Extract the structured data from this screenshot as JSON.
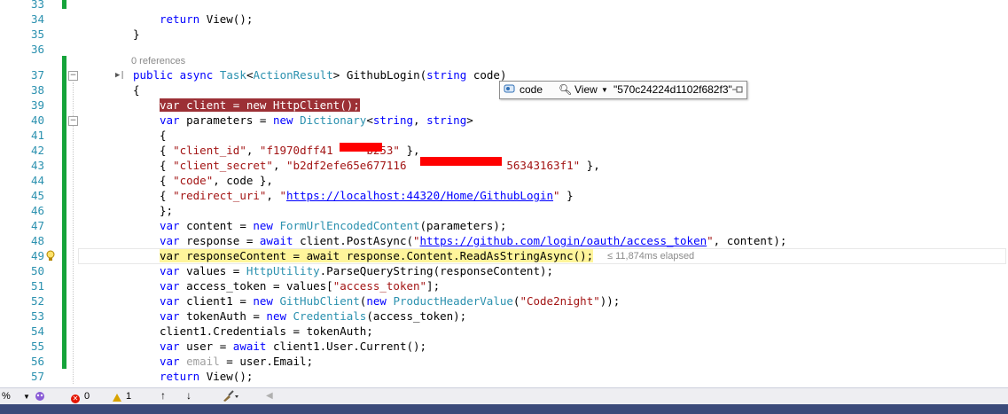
{
  "editor": {
    "codelens": "0 references",
    "elapsed": "≤ 11,874ms elapsed",
    "lines": [
      {
        "num": "33",
        "tokens": []
      },
      {
        "num": "34",
        "tokens": [
          {
            "t": "return ",
            "c": "kw"
          },
          {
            "t": "View();",
            "c": ""
          }
        ]
      },
      {
        "num": "35",
        "tokens": [
          {
            "t": "}",
            "c": ""
          }
        ]
      },
      {
        "num": "36",
        "tokens": []
      },
      {
        "num": "37",
        "tokens": [
          {
            "t": "public async ",
            "c": "kw"
          },
          {
            "t": "Task",
            "c": "ty"
          },
          {
            "t": "<",
            "c": ""
          },
          {
            "t": "ActionResult",
            "c": "ty"
          },
          {
            "t": "> GithubLogin(",
            "c": ""
          },
          {
            "t": "string",
            "c": "kw"
          },
          {
            "t": " code)",
            "c": ""
          }
        ]
      },
      {
        "num": "38",
        "tokens": [
          {
            "t": "{",
            "c": ""
          }
        ]
      },
      {
        "num": "39",
        "tokens": [
          {
            "t": "var client = new HttpClient();",
            "c": "bp"
          }
        ]
      },
      {
        "num": "40",
        "tokens": [
          {
            "t": "var ",
            "c": "kw"
          },
          {
            "t": "parameters = ",
            "c": ""
          },
          {
            "t": "new ",
            "c": "kw"
          },
          {
            "t": "Dictionary",
            "c": "ty"
          },
          {
            "t": "<",
            "c": ""
          },
          {
            "t": "string",
            "c": "kw"
          },
          {
            "t": ", ",
            "c": ""
          },
          {
            "t": "string",
            "c": "kw"
          },
          {
            "t": ">",
            "c": ""
          }
        ]
      },
      {
        "num": "41",
        "tokens": [
          {
            "t": "{",
            "c": ""
          }
        ]
      },
      {
        "num": "42",
        "tokens": [
          {
            "t": "{ ",
            "c": ""
          },
          {
            "t": "\"client_id\"",
            "c": "st"
          },
          {
            "t": ", ",
            "c": ""
          },
          {
            "t": "\"f1970dff41     b253\"",
            "c": "st"
          },
          {
            "t": " },",
            "c": ""
          }
        ]
      },
      {
        "num": "43",
        "tokens": [
          {
            "t": "{ ",
            "c": ""
          },
          {
            "t": "\"client_secret\"",
            "c": "st"
          },
          {
            "t": ", ",
            "c": ""
          },
          {
            "t": "\"b2df2efe65e677116               56343163f1\"",
            "c": "st"
          },
          {
            "t": " },",
            "c": ""
          }
        ]
      },
      {
        "num": "44",
        "tokens": [
          {
            "t": "{ ",
            "c": ""
          },
          {
            "t": "\"code\"",
            "c": "st"
          },
          {
            "t": ", code },",
            "c": ""
          }
        ]
      },
      {
        "num": "45",
        "tokens": [
          {
            "t": "{ ",
            "c": ""
          },
          {
            "t": "\"redirect_uri\"",
            "c": "st"
          },
          {
            "t": ", ",
            "c": ""
          },
          {
            "t": "\"",
            "c": "st"
          },
          {
            "t": "https://localhost:44320/Home/GithubLogin",
            "c": "url"
          },
          {
            "t": "\"",
            "c": "st"
          },
          {
            "t": " }",
            "c": ""
          }
        ]
      },
      {
        "num": "46",
        "tokens": [
          {
            "t": "};",
            "c": ""
          }
        ]
      },
      {
        "num": "47",
        "tokens": [
          {
            "t": "var ",
            "c": "kw"
          },
          {
            "t": "content = ",
            "c": ""
          },
          {
            "t": "new ",
            "c": "kw"
          },
          {
            "t": "FormUrlEncodedContent",
            "c": "ty"
          },
          {
            "t": "(parameters);",
            "c": ""
          }
        ]
      },
      {
        "num": "48",
        "tokens": [
          {
            "t": "var ",
            "c": "kw"
          },
          {
            "t": "response = ",
            "c": ""
          },
          {
            "t": "await ",
            "c": "kw"
          },
          {
            "t": "client.PostAsync(",
            "c": ""
          },
          {
            "t": "\"",
            "c": "st"
          },
          {
            "t": "https://github.com/login/oauth/access_token",
            "c": "url"
          },
          {
            "t": "\"",
            "c": "st"
          },
          {
            "t": ", content);",
            "c": ""
          }
        ]
      },
      {
        "num": "49",
        "tokens": [
          {
            "t": "var responseContent = await response.Content.ReadAsStringAsync();",
            "c": "cur"
          }
        ]
      },
      {
        "num": "50",
        "tokens": [
          {
            "t": "var ",
            "c": "kw"
          },
          {
            "t": "values = ",
            "c": ""
          },
          {
            "t": "HttpUtility",
            "c": "ty"
          },
          {
            "t": ".ParseQueryString(responseContent);",
            "c": ""
          }
        ]
      },
      {
        "num": "51",
        "tokens": [
          {
            "t": "var ",
            "c": "kw"
          },
          {
            "t": "access_token = values[",
            "c": ""
          },
          {
            "t": "\"access_token\"",
            "c": "st"
          },
          {
            "t": "];",
            "c": ""
          }
        ]
      },
      {
        "num": "52",
        "tokens": [
          {
            "t": "var ",
            "c": "kw"
          },
          {
            "t": "client1 = ",
            "c": ""
          },
          {
            "t": "new ",
            "c": "kw"
          },
          {
            "t": "GitHubClient",
            "c": "ty"
          },
          {
            "t": "(",
            "c": ""
          },
          {
            "t": "new ",
            "c": "kw"
          },
          {
            "t": "ProductHeaderValue",
            "c": "ty"
          },
          {
            "t": "(",
            "c": ""
          },
          {
            "t": "\"Code2night\"",
            "c": "st"
          },
          {
            "t": "));",
            "c": ""
          }
        ]
      },
      {
        "num": "53",
        "tokens": [
          {
            "t": "var ",
            "c": "kw"
          },
          {
            "t": "tokenAuth = ",
            "c": ""
          },
          {
            "t": "new ",
            "c": "kw"
          },
          {
            "t": "Credentials",
            "c": "ty"
          },
          {
            "t": "(access_token);",
            "c": ""
          }
        ]
      },
      {
        "num": "54",
        "tokens": [
          {
            "t": "client1.Credentials = tokenAuth;",
            "c": ""
          }
        ]
      },
      {
        "num": "55",
        "tokens": [
          {
            "t": "var ",
            "c": "kw"
          },
          {
            "t": "user = ",
            "c": ""
          },
          {
            "t": "await ",
            "c": "kw"
          },
          {
            "t": "client1.User.Current();",
            "c": ""
          }
        ]
      },
      {
        "num": "56",
        "tokens": [
          {
            "t": "var ",
            "c": "kw"
          },
          {
            "t": "email",
            "c": "muted"
          },
          {
            "t": " = user.Email;",
            "c": ""
          }
        ]
      },
      {
        "num": "57",
        "tokens": [
          {
            "t": "return ",
            "c": "kw"
          },
          {
            "t": "View();",
            "c": ""
          }
        ]
      }
    ]
  },
  "datatip": {
    "variable": "code",
    "visualizer": "View",
    "value": "\"570c24224d1102f682f3\""
  },
  "statusbar": {
    "zoom": "%",
    "errors": "0",
    "warnings": "1",
    "up_arrow": "↑",
    "down_arrow": "↓"
  },
  "colors": {
    "breakpoint": "#9c3035",
    "current_statement": "#fff59b",
    "keyword": "#0000ff",
    "type": "#2b91af",
    "string": "#a31515",
    "change_bar": "#15a33a"
  }
}
